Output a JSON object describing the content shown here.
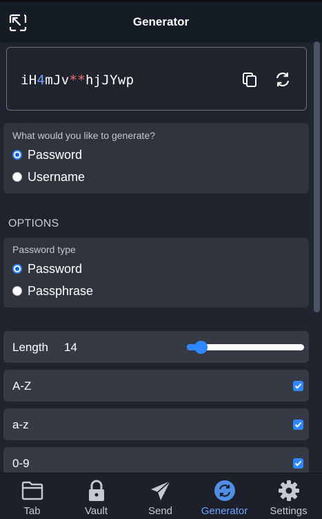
{
  "header": {
    "title": "Generator",
    "popout_icon": "popout-icon"
  },
  "password": {
    "parts": [
      {
        "text": "iH",
        "kind": "letter"
      },
      {
        "text": "4",
        "kind": "num"
      },
      {
        "text": "mJv",
        "kind": "letter"
      },
      {
        "text": "**",
        "kind": "sym"
      },
      {
        "text": "hjJYwp",
        "kind": "letter"
      }
    ],
    "copy_icon": "copy-icon",
    "regenerate_icon": "refresh-icon"
  },
  "generate_type": {
    "label": "What would you like to generate?",
    "options": [
      {
        "label": "Password",
        "checked": true
      },
      {
        "label": "Username",
        "checked": false
      }
    ]
  },
  "options": {
    "section_title": "OPTIONS",
    "password_type": {
      "label": "Password type",
      "options": [
        {
          "label": "Password",
          "checked": true
        },
        {
          "label": "Passphrase",
          "checked": false
        }
      ]
    },
    "length": {
      "label": "Length",
      "value": "14",
      "slider_fraction": 0.12
    },
    "toggles": [
      {
        "label": "A-Z",
        "checked": true
      },
      {
        "label": "a-z",
        "checked": true
      },
      {
        "label": "0-9",
        "checked": true
      }
    ]
  },
  "nav": {
    "items": [
      {
        "label": "Tab",
        "icon": "folder-icon",
        "active": false
      },
      {
        "label": "Vault",
        "icon": "lock-icon",
        "active": false
      },
      {
        "label": "Send",
        "icon": "paper-plane-icon",
        "active": false
      },
      {
        "label": "Generator",
        "icon": "refresh-circle-icon",
        "active": true
      },
      {
        "label": "Settings",
        "icon": "gear-icon",
        "active": false
      }
    ]
  },
  "colors": {
    "accent": "#2f88ff",
    "number": "#6fa2ff",
    "symbol": "#ff6b6b",
    "background": "#1f242e",
    "card": "#2f343d"
  }
}
